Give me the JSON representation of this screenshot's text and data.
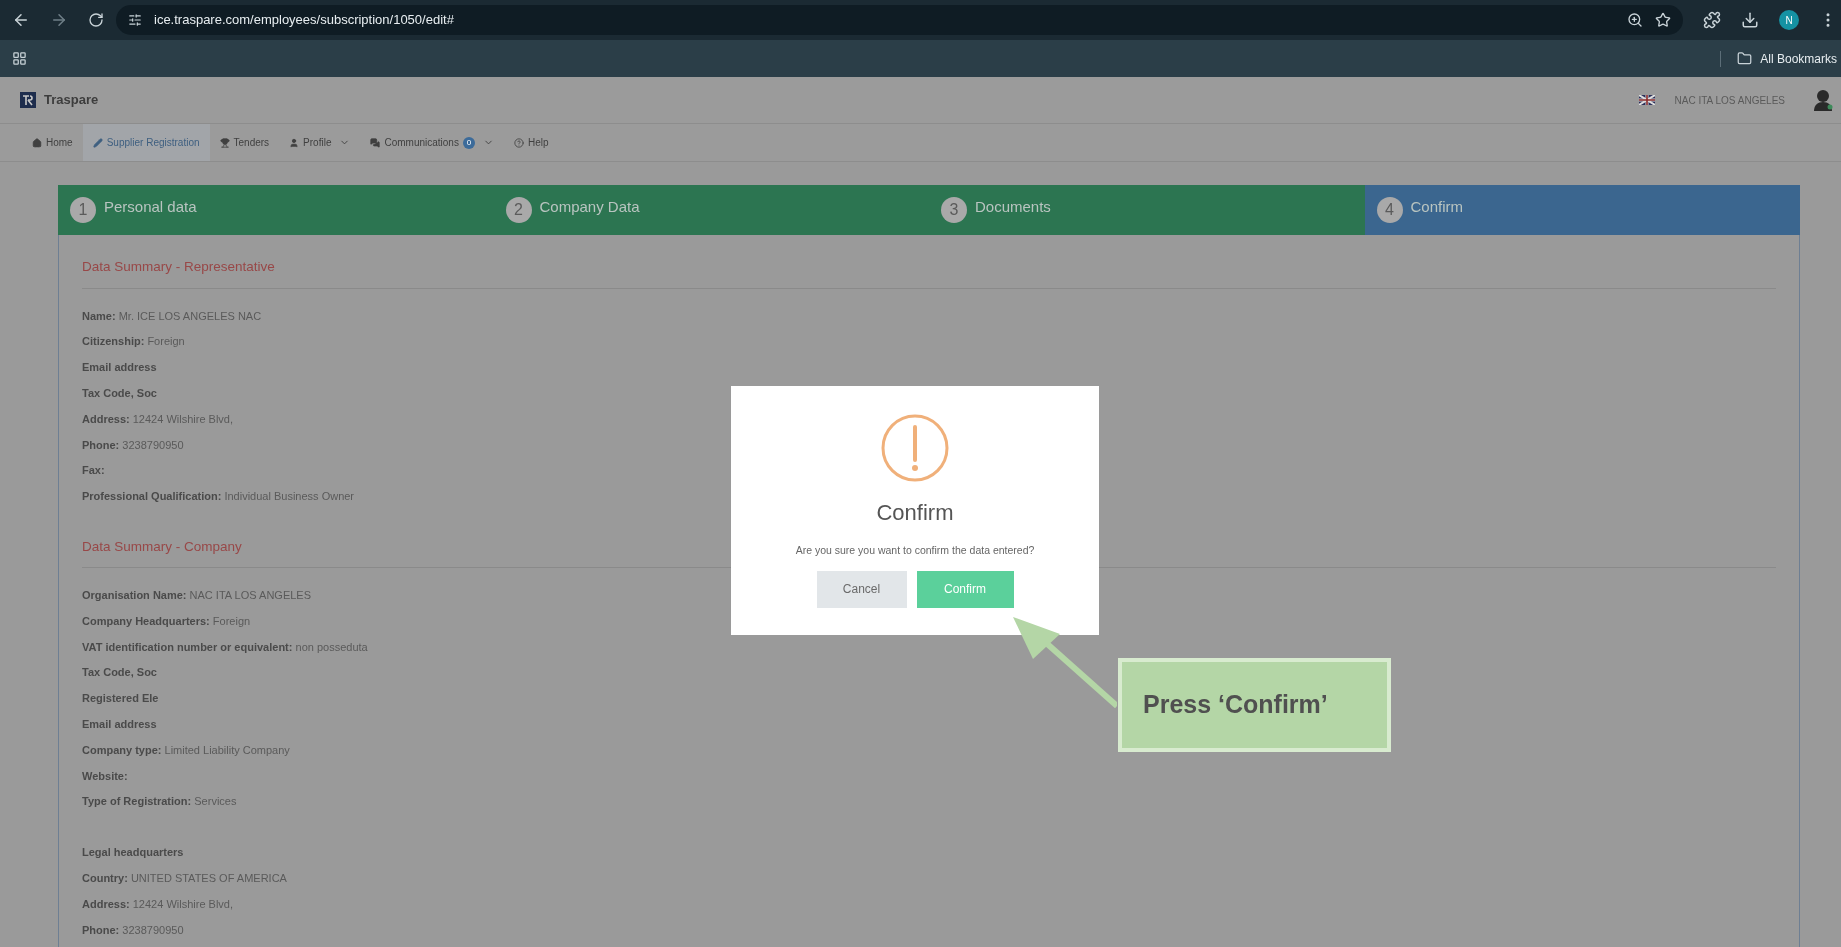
{
  "browser": {
    "url": "ice.traspare.com/employees/subscription/1050/edit#",
    "profile_initial": "N",
    "bookmarks_label": "All Bookmarks"
  },
  "header": {
    "brand": "Traspare",
    "user_name": "NAC ITA LOS ANGELES"
  },
  "nav": [
    {
      "label": "Home",
      "selected": false,
      "dropdown": false
    },
    {
      "label": "Supplier Registration",
      "selected": true,
      "dropdown": false
    },
    {
      "label": "Tenders",
      "selected": false,
      "dropdown": false
    },
    {
      "label": "Profile",
      "selected": false,
      "dropdown": true
    },
    {
      "label": "Communications",
      "selected": false,
      "badge": "0",
      "dropdown": true
    },
    {
      "label": "Help",
      "selected": false,
      "dropdown": false
    }
  ],
  "steps": [
    {
      "number": "1",
      "label": "Personal data",
      "selected": false
    },
    {
      "number": "2",
      "label": "Company Data",
      "selected": false
    },
    {
      "number": "3",
      "label": "Documents",
      "selected": false
    },
    {
      "number": "4",
      "label": "Confirm",
      "selected": true
    }
  ],
  "sections": [
    {
      "title": "Data Summary - Representative",
      "rows": [
        {
          "kind": "field",
          "label": "Name:",
          "value": "Mr. ICE LOS ANGELES NAC"
        },
        {
          "kind": "field",
          "label": "Citizenship:",
          "value": "Foreign"
        },
        {
          "kind": "field",
          "label": "Email address"
        },
        {
          "kind": "field",
          "label": "Tax Code, Soc"
        },
        {
          "kind": "field",
          "label": "Address:",
          "value": "12424 Wilshire Blvd,"
        },
        {
          "kind": "field",
          "label": "Phone:",
          "value": "3238790950"
        },
        {
          "kind": "field",
          "label": "Fax:"
        },
        {
          "kind": "field",
          "label": "Professional Qualification:",
          "value": "Individual Business Owner"
        }
      ]
    },
    {
      "title": "Data Summary - Company",
      "rows": [
        {
          "kind": "field",
          "label": "Organisation Name:",
          "value": "NAC ITA LOS ANGELES"
        },
        {
          "kind": "field",
          "label": "Company Headquarters:",
          "value": "Foreign"
        },
        {
          "kind": "field",
          "label": "VAT identification number or equivalent:",
          "value": "non posseduta"
        },
        {
          "kind": "field",
          "label": "Tax Code, Soc"
        },
        {
          "kind": "field",
          "label": "Registered Ele"
        },
        {
          "kind": "field",
          "label": "Email address"
        },
        {
          "kind": "field",
          "label": "Company type:",
          "value": "Limited Liability Company"
        },
        {
          "kind": "field",
          "label": "Website:"
        },
        {
          "kind": "field",
          "label": "Type of Registration:",
          "value": "Services"
        },
        {
          "kind": "subheading",
          "label": "Legal headquarters"
        },
        {
          "kind": "field",
          "label": "Country:",
          "value": "UNITED STATES OF AMERICA"
        },
        {
          "kind": "field",
          "label": "Address:",
          "value": "12424 Wilshire Blvd,"
        },
        {
          "kind": "field",
          "label": "Phone:",
          "value": "3238790950"
        }
      ]
    }
  ],
  "dialog": {
    "title": "Confirm",
    "message": "Are you sure you want to confirm the data entered?",
    "buttons": [
      {
        "label": "Cancel",
        "kind": "secondary"
      },
      {
        "label": "Confirm",
        "kind": "primary"
      }
    ]
  },
  "callout": {
    "text": "Press ‘Confirm’"
  }
}
